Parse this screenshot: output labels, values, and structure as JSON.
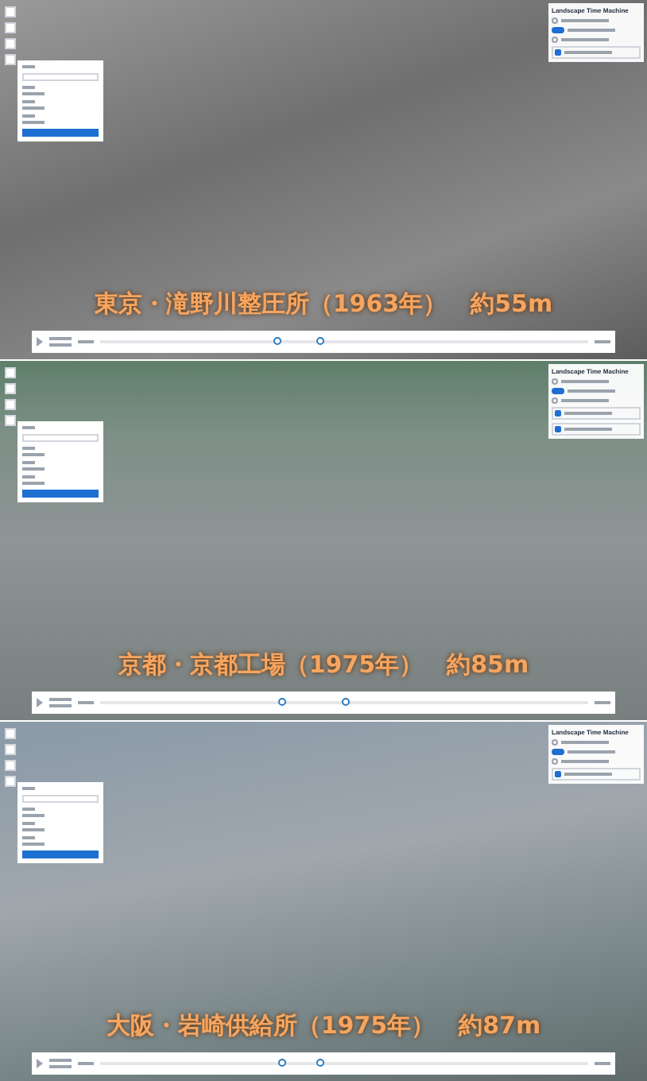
{
  "panels": [
    {
      "kind": "grayscale",
      "caption": "東京・滝野川整圧所（1963年）　約55m",
      "widget": {
        "title": "Landscape Time Machine",
        "rows": [
          {
            "kind": "radio",
            "on": false
          },
          {
            "kind": "switch",
            "on": true
          },
          {
            "kind": "radio",
            "on": false
          },
          {
            "kind": "layer",
            "on": true
          }
        ]
      },
      "timeline": {
        "thumbs": [
          {
            "level": 0.36
          },
          {
            "level": 0.45
          }
        ]
      }
    },
    {
      "kind": "green",
      "caption": "京都・京都工場（1975年）　約85m",
      "widget": {
        "title": "Landscape Time Machine",
        "rows": [
          {
            "kind": "radio",
            "on": false
          },
          {
            "kind": "switch",
            "on": true
          },
          {
            "kind": "radio",
            "on": false
          },
          {
            "kind": "layer",
            "on": true
          },
          {
            "kind": "layer",
            "on": true
          }
        ]
      },
      "timeline": {
        "thumbs": [
          {
            "level": 0.37
          },
          {
            "level": 0.5
          }
        ]
      }
    },
    {
      "kind": "color",
      "caption": "大阪・岩崎供給所（1975年）　約87m",
      "widget": {
        "title": "Landscape Time Machine",
        "rows": [
          {
            "kind": "radio",
            "on": false
          },
          {
            "kind": "switch",
            "on": true
          },
          {
            "kind": "radio",
            "on": false
          },
          {
            "kind": "layer",
            "on": true
          }
        ]
      },
      "timeline": {
        "thumbs": [
          {
            "level": 0.37
          },
          {
            "level": 0.45
          }
        ]
      }
    }
  ]
}
